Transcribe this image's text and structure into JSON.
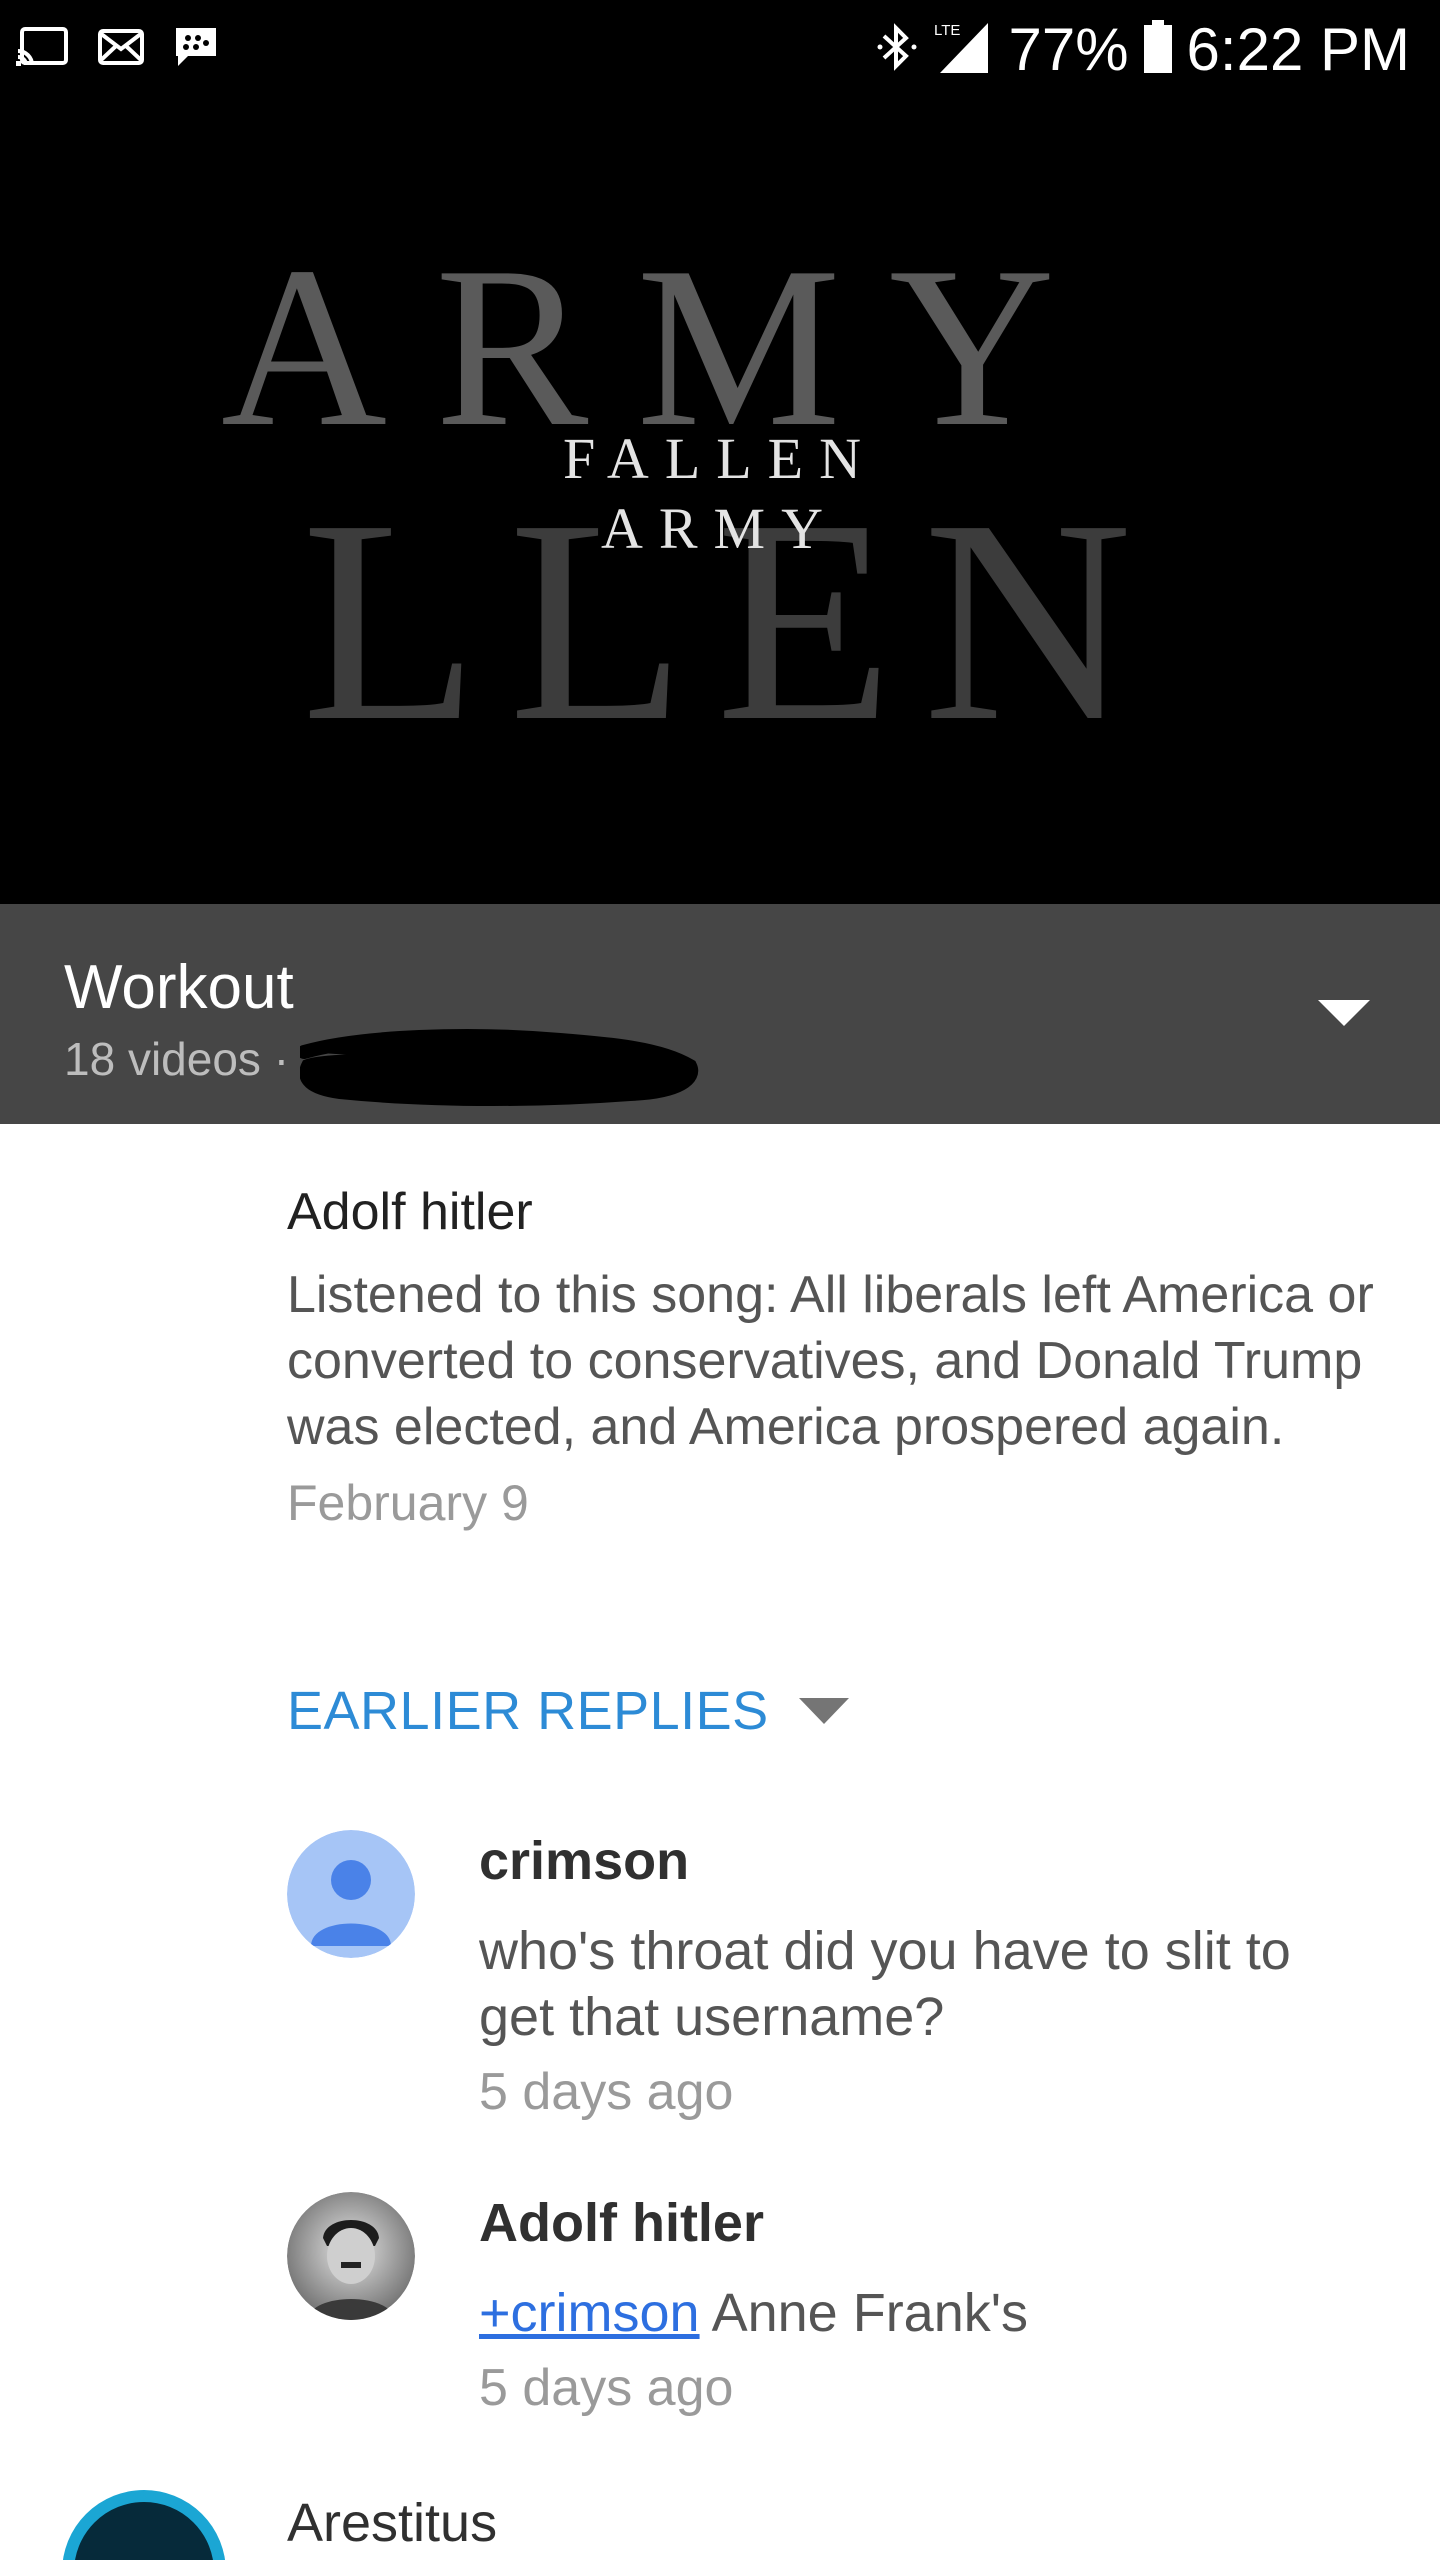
{
  "status_bar": {
    "battery": "77%",
    "time": "6:22 PM",
    "network": "LTE",
    "left_icons": [
      "cast-icon",
      "mail-icon",
      "bbm-icon"
    ],
    "right_icons": [
      "bluetooth-icon",
      "signal-icon",
      "battery-icon"
    ]
  },
  "video": {
    "bg_big_line1": "ARMY",
    "bg_big_line2": "LLEN",
    "title_line1": "FALLEN",
    "title_line2": "ARMY"
  },
  "playlist": {
    "title": "Workout",
    "count": "18 videos ·"
  },
  "main_comment": {
    "author": "Adolf hitler",
    "text": "Listened to this song: All liberals left America or converted to conservatives, and Donald Trump was elected, and America prospered again.",
    "time": "February 9"
  },
  "earlier_replies": "EARLIER REPLIES",
  "replies": [
    {
      "author": "crimson",
      "text": "who's throat did you have to slit to get that username?",
      "time": "5 days ago"
    },
    {
      "author": "Adolf hitler",
      "mention": "+crimson",
      "text": " Anne Frank's",
      "time": "5 days ago"
    }
  ],
  "next_comment": {
    "author": "Arestitus"
  },
  "colors": {
    "accent": "#2d8bd6",
    "playlist_bg": "#464646",
    "status_bar_bg": "#000000"
  }
}
